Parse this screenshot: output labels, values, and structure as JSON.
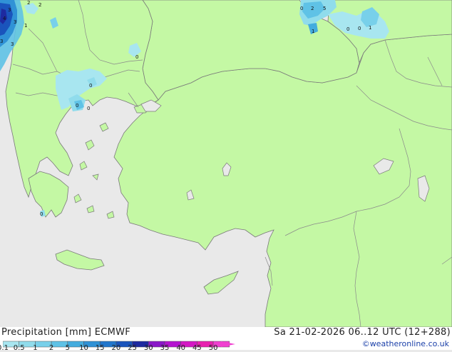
{
  "footer": {
    "left_title": "Precipitation [mm]  ECMWF",
    "right_title": "Sa 21-02-2026 06..12 UTC (12+288)",
    "credit": "©weatheronline.co.uk"
  },
  "legend": {
    "ticks": [
      "0.1",
      "0.5",
      "1",
      "2",
      "5",
      "10",
      "15",
      "20",
      "25",
      "30",
      "35",
      "40",
      "45",
      "50"
    ],
    "colors": [
      "#a8e6f0",
      "#90dcec",
      "#78d0ea",
      "#5fc2e6",
      "#44acde",
      "#3092d6",
      "#2276cc",
      "#1a54bc",
      "#1e2aa0",
      "#8a18c8",
      "#b414d0",
      "#d418c4",
      "#e822b0",
      "#f040d0"
    ]
  },
  "map": {
    "colors": {
      "land": "#c4f8a4",
      "sea": "#e9e9e9",
      "border": "#8a8a8a",
      "coast": "#7a7a7a"
    },
    "precip_labels": [
      "2",
      "2",
      "4",
      "3",
      "1",
      "3",
      "3",
      "5",
      "0",
      "2",
      "3",
      "0",
      "0",
      "1",
      "1",
      "0",
      "0",
      "0",
      "0",
      "0"
    ]
  }
}
